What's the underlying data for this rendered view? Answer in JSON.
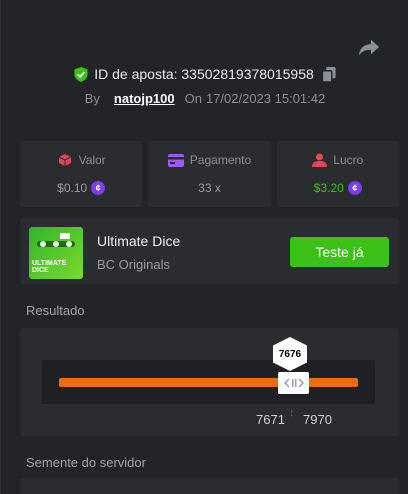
{
  "header": {
    "bet_id": "ID de aposta: 33502819378015958",
    "by_label": "By",
    "username": "natojp100",
    "on_label": "On",
    "date": "17/02/2023 15:01:42"
  },
  "stats": [
    {
      "label": "Valor",
      "value": "$0.10",
      "icon": "dice-icon",
      "coin": true
    },
    {
      "label": "Pagamento",
      "value": "33 x",
      "icon": "card-icon",
      "coin": false
    },
    {
      "label": "Lucro",
      "value": "$3.20",
      "icon": "user-icon",
      "coin": true
    }
  ],
  "coin_symbol": "¢",
  "game": {
    "title": "Ultimate Dice",
    "provider": "BC Originals",
    "thumb_text": "ULTIMATE DICE",
    "button_label": "Teste já"
  },
  "result": {
    "section_label": "Resultado",
    "roll": "7676",
    "range_low": "7671",
    "range_high": "7970"
  },
  "seed": {
    "section_label": "Semente do servidor"
  },
  "colors": {
    "accent_green": "#3bc117",
    "bar_orange": "#f06b0d",
    "coin_purple": "#7b3ff2",
    "stat_red": "#e24858"
  }
}
